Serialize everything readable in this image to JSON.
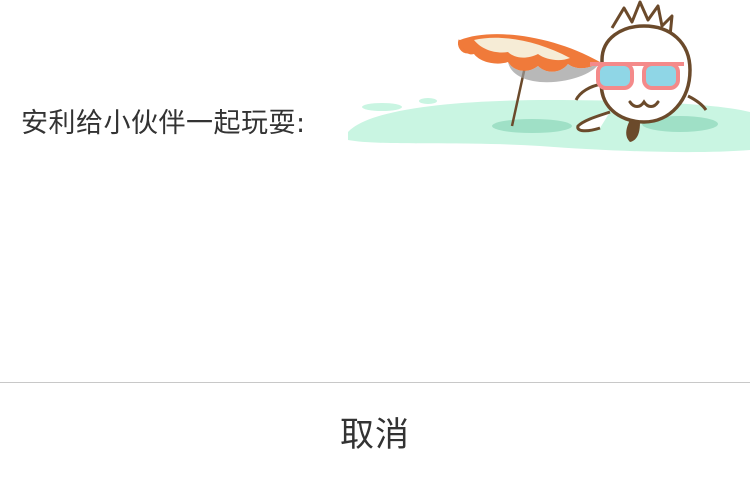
{
  "share_dialog": {
    "title": "安利给小伙伴一起玩耍:",
    "illustration_name": "mascot-sunglasses-beach-umbrella",
    "cancel_label": "取消"
  },
  "colors": {
    "text": "#333333",
    "divider": "#c8c8c8",
    "umbrella_orange": "#f07a3a",
    "umbrella_cream": "#f6ecd6",
    "sand_mint": "#c9f5e2",
    "mascot_outline": "#6b4a2b",
    "glasses_pink": "#f48a8a",
    "lens_blue": "#8fd6e6"
  }
}
